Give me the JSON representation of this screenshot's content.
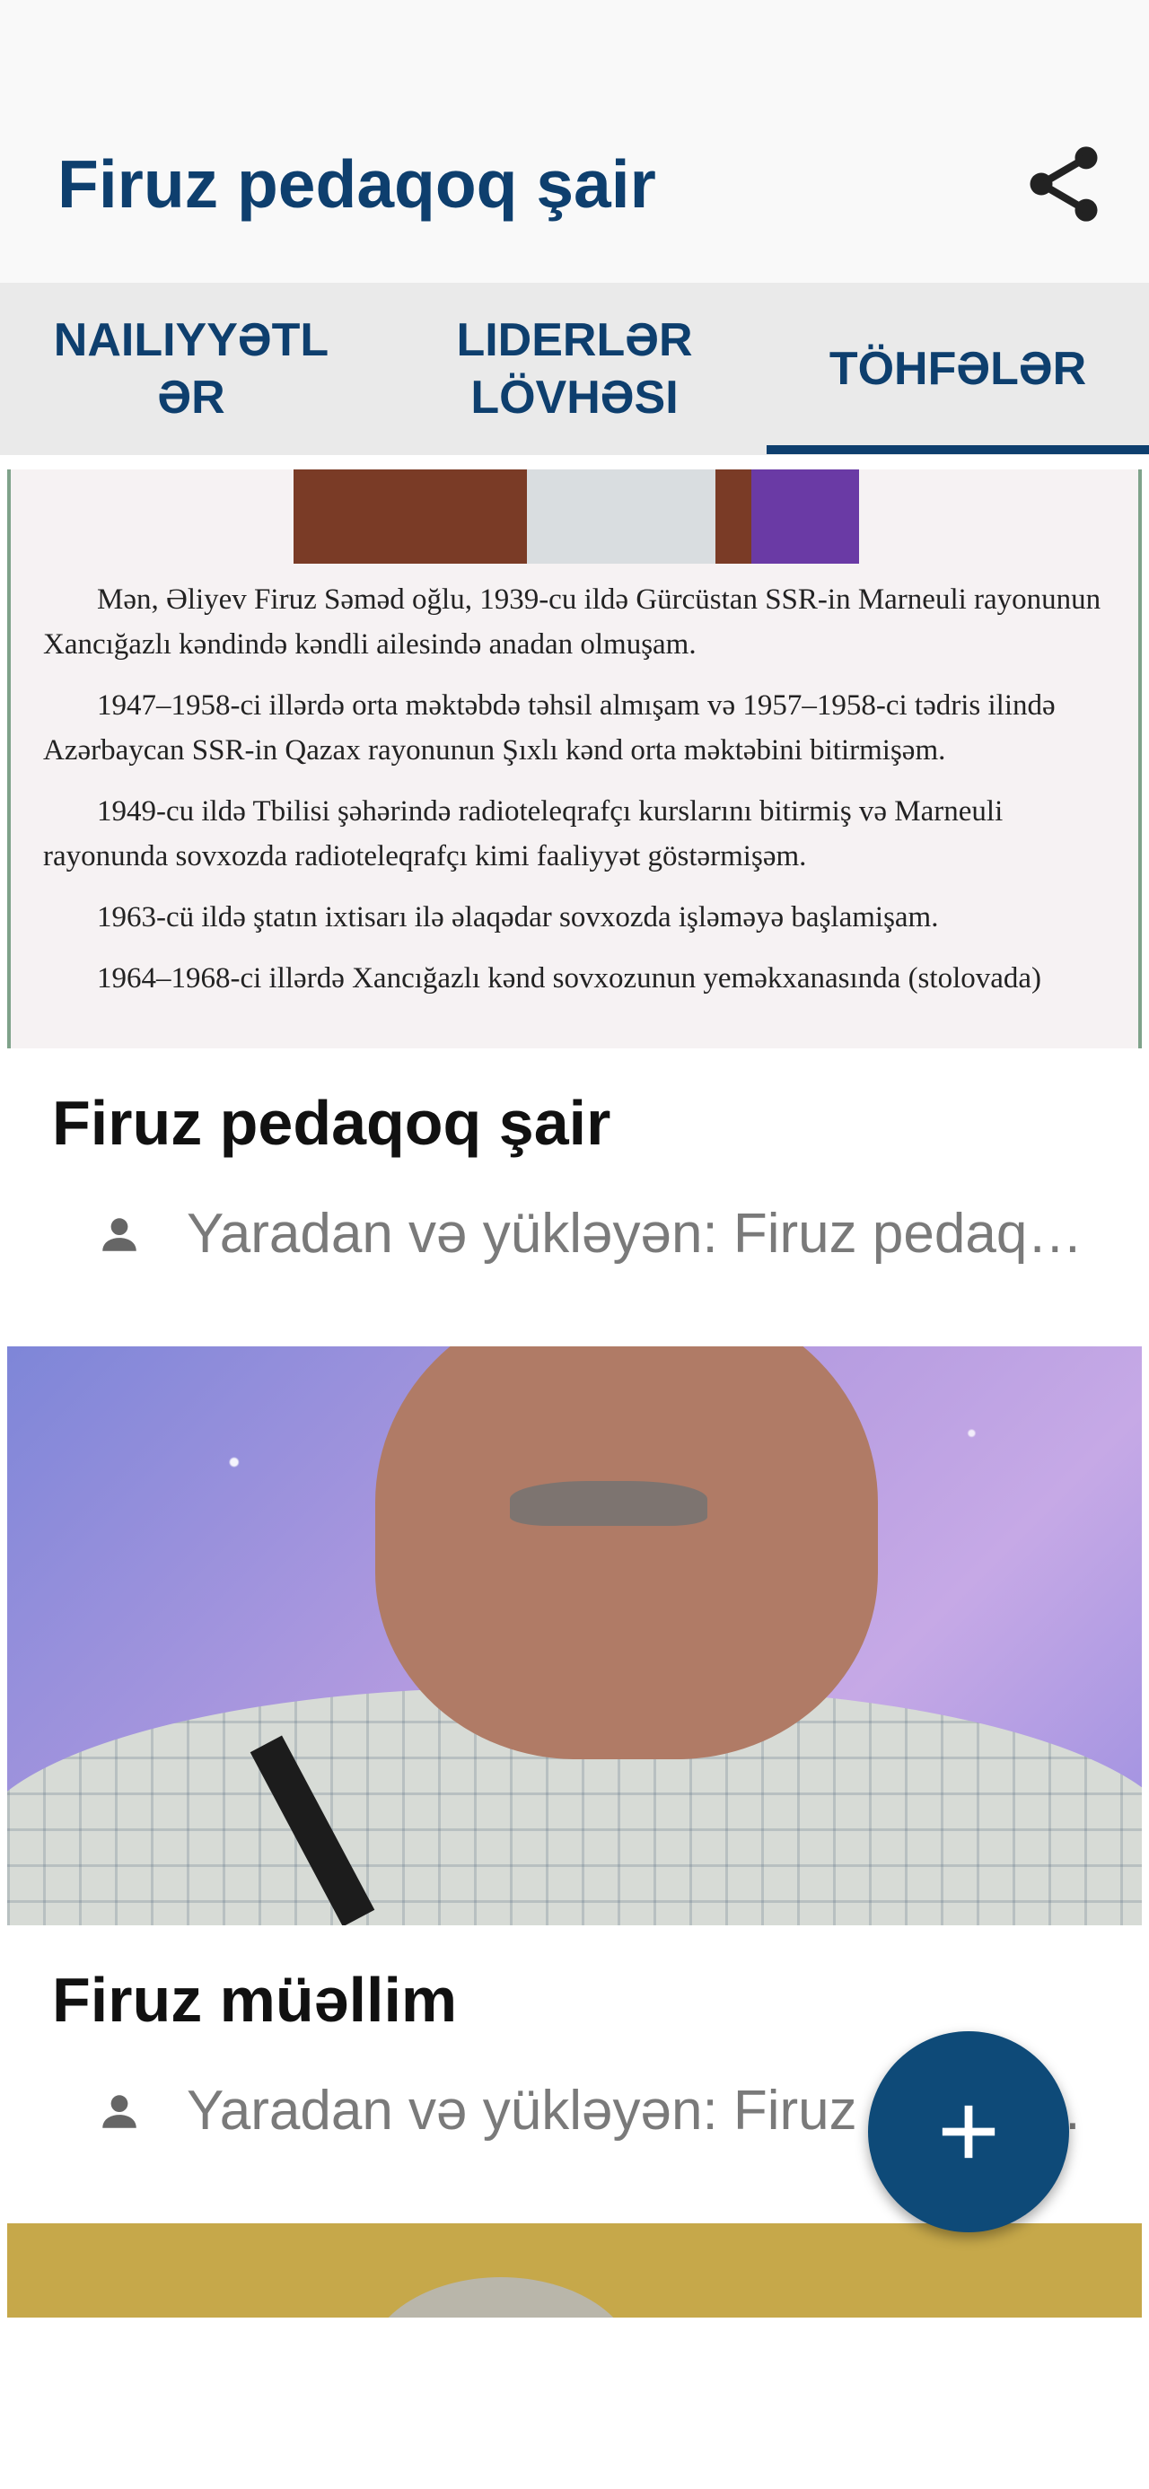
{
  "app_bar": {
    "title": "Firuz pedaqoq şair",
    "share_icon": "share-icon"
  },
  "tabs": [
    {
      "label": "NAILIYYƏTL\nƏR",
      "selected": false
    },
    {
      "label": "LIDERLƏR\nLÖVHƏSI",
      "selected": false
    },
    {
      "label": "TÖHFƏLƏR",
      "selected": true
    }
  ],
  "contributions": [
    {
      "title": "Firuz pedaqoq şair",
      "subtitle": "Yaradan və yükləyən: Firuz pedaqoq şair",
      "document_text": [
        "Mən, Əliyev Firuz Səməd oğlu, 1939-cu ildə Gürcüstan SSR-in Marneuli rayonunun Xancığazlı kəndində kəndli ailesində anadan olmuşam.",
        "1947–1958-ci illərdə orta məktəbdə təhsil almışam və 1957–1958-ci tədris ilində Azərbaycan SSR-in Qazax rayonunun Şıxlı kənd orta məktəbini bitirmişəm.",
        "1949-cu ildə Tbilisi şəhərində radioteleqrafçı kurslarını bitirmiş və Marneuli rayonunda sovxozda radioteleqrafçı kimi faaliyyət göstərmişəm.",
        "1963-cü ildə ştatın ixtisarı ilə əlaqədar sovxozda işləməyə başlamişam.",
        "1964–1968-ci illərdə Xancığazlı kənd sovxozunun yeməkxanasında (stolovada)"
      ]
    },
    {
      "title": "Firuz müəllim",
      "subtitle": "Yaradan və yükləyən: Firuz pedaqoq şair"
    }
  ],
  "fab": {
    "icon": "plus-icon"
  },
  "colors": {
    "primary": "#0e3f6e",
    "fab": "#0e4a78",
    "subtitle": "#7a7a7a"
  }
}
